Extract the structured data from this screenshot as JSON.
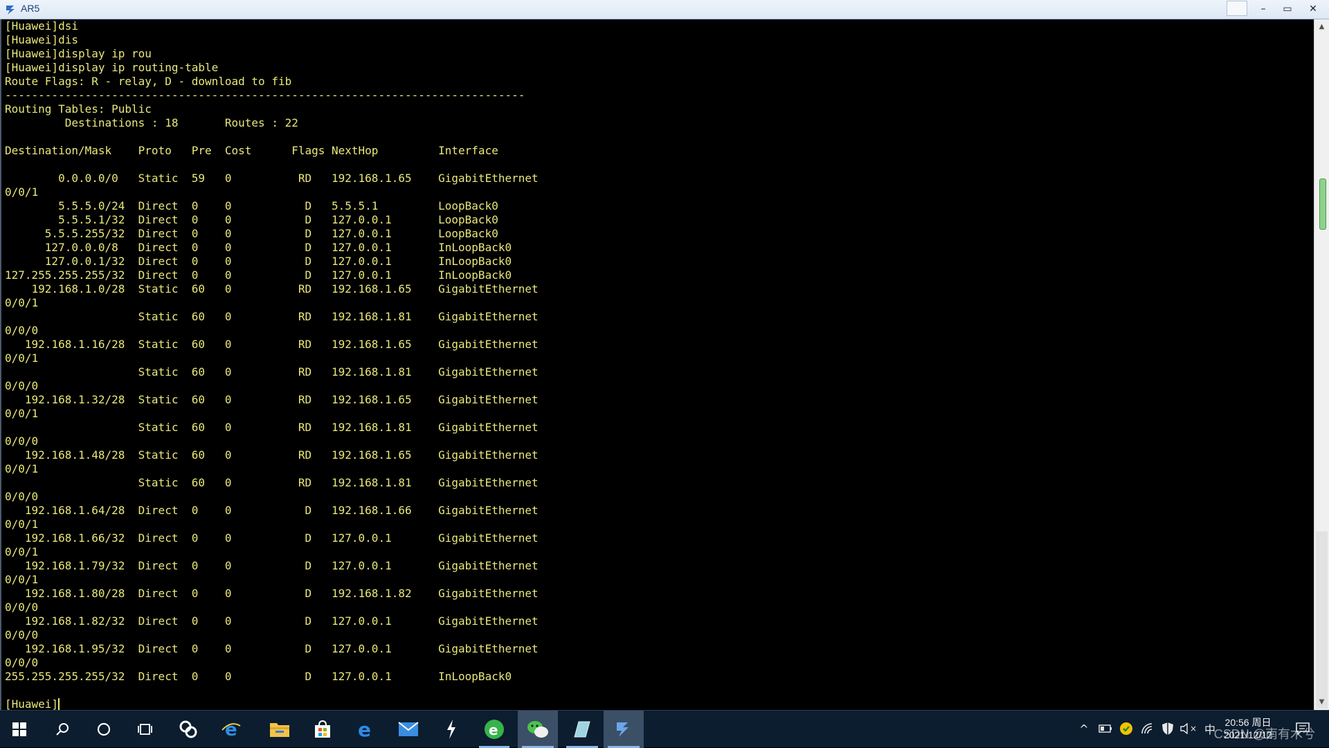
{
  "window": {
    "title": "AR5"
  },
  "titlebar": {
    "minimize": "–",
    "maximize": "▭",
    "close": "✕"
  },
  "terminal": {
    "lines": [
      "[Huawei]dsi",
      "[Huawei]dis",
      "[Huawei]display ip rou",
      "[Huawei]display ip routing-table",
      "Route Flags: R - relay, D - download to fib",
      "------------------------------------------------------------------------------",
      "Routing Tables: Public",
      "         Destinations : 18       Routes : 22",
      "",
      "Destination/Mask    Proto   Pre  Cost      Flags NextHop         Interface",
      "",
      "        0.0.0.0/0   Static  59   0          RD   192.168.1.65    GigabitEthernet",
      "0/0/1",
      "        5.5.5.0/24  Direct  0    0           D   5.5.5.1         LoopBack0",
      "        5.5.5.1/32  Direct  0    0           D   127.0.0.1       LoopBack0",
      "      5.5.5.255/32  Direct  0    0           D   127.0.0.1       LoopBack0",
      "      127.0.0.0/8   Direct  0    0           D   127.0.0.1       InLoopBack0",
      "      127.0.0.1/32  Direct  0    0           D   127.0.0.1       InLoopBack0",
      "127.255.255.255/32  Direct  0    0           D   127.0.0.1       InLoopBack0",
      "    192.168.1.0/28  Static  60   0          RD   192.168.1.65    GigabitEthernet",
      "0/0/1",
      "                    Static  60   0          RD   192.168.1.81    GigabitEthernet",
      "0/0/0",
      "   192.168.1.16/28  Static  60   0          RD   192.168.1.65    GigabitEthernet",
      "0/0/1",
      "                    Static  60   0          RD   192.168.1.81    GigabitEthernet",
      "0/0/0",
      "   192.168.1.32/28  Static  60   0          RD   192.168.1.65    GigabitEthernet",
      "0/0/1",
      "                    Static  60   0          RD   192.168.1.81    GigabitEthernet",
      "0/0/0",
      "   192.168.1.48/28  Static  60   0          RD   192.168.1.65    GigabitEthernet",
      "0/0/1",
      "                    Static  60   0          RD   192.168.1.81    GigabitEthernet",
      "0/0/0",
      "   192.168.1.64/28  Direct  0    0           D   192.168.1.66    GigabitEthernet",
      "0/0/1",
      "   192.168.1.66/32  Direct  0    0           D   127.0.0.1       GigabitEthernet",
      "0/0/1",
      "   192.168.1.79/32  Direct  0    0           D   127.0.0.1       GigabitEthernet",
      "0/0/1",
      "   192.168.1.80/28  Direct  0    0           D   192.168.1.82    GigabitEthernet",
      "0/0/0",
      "   192.168.1.82/32  Direct  0    0           D   127.0.0.1       GigabitEthernet",
      "0/0/0",
      "   192.168.1.95/32  Direct  0    0           D   127.0.0.1       GigabitEthernet",
      "0/0/0",
      "255.255.255.255/32  Direct  0    0           D   127.0.0.1       InLoopBack0",
      "",
      "[Huawei]"
    ],
    "text_color": "#e9e77a",
    "background": "#000000"
  },
  "scrollbar": {
    "up": "▲",
    "down": "▼"
  },
  "taskbar": {
    "apps": [
      {
        "name": "start-icon"
      },
      {
        "name": "search-icon"
      },
      {
        "name": "cortana-icon"
      },
      {
        "name": "task-view-icon"
      },
      {
        "name": "app-s-icon"
      },
      {
        "name": "ie-icon"
      },
      {
        "name": "file-explorer-icon"
      },
      {
        "name": "store-icon"
      },
      {
        "name": "edge-icon"
      },
      {
        "name": "mail-icon"
      },
      {
        "name": "lightning-app-icon"
      },
      {
        "name": "browser-360-icon"
      },
      {
        "name": "wechat-icon"
      },
      {
        "name": "notes-app-icon"
      },
      {
        "name": "ar5-terminal-icon"
      }
    ],
    "tray": {
      "chevron": "^",
      "ime": "中",
      "volume_muted": "×"
    },
    "clock": {
      "time": "20:56 周日",
      "date": "2021/12/12"
    },
    "watermark": "CSDN @南有木兮"
  }
}
